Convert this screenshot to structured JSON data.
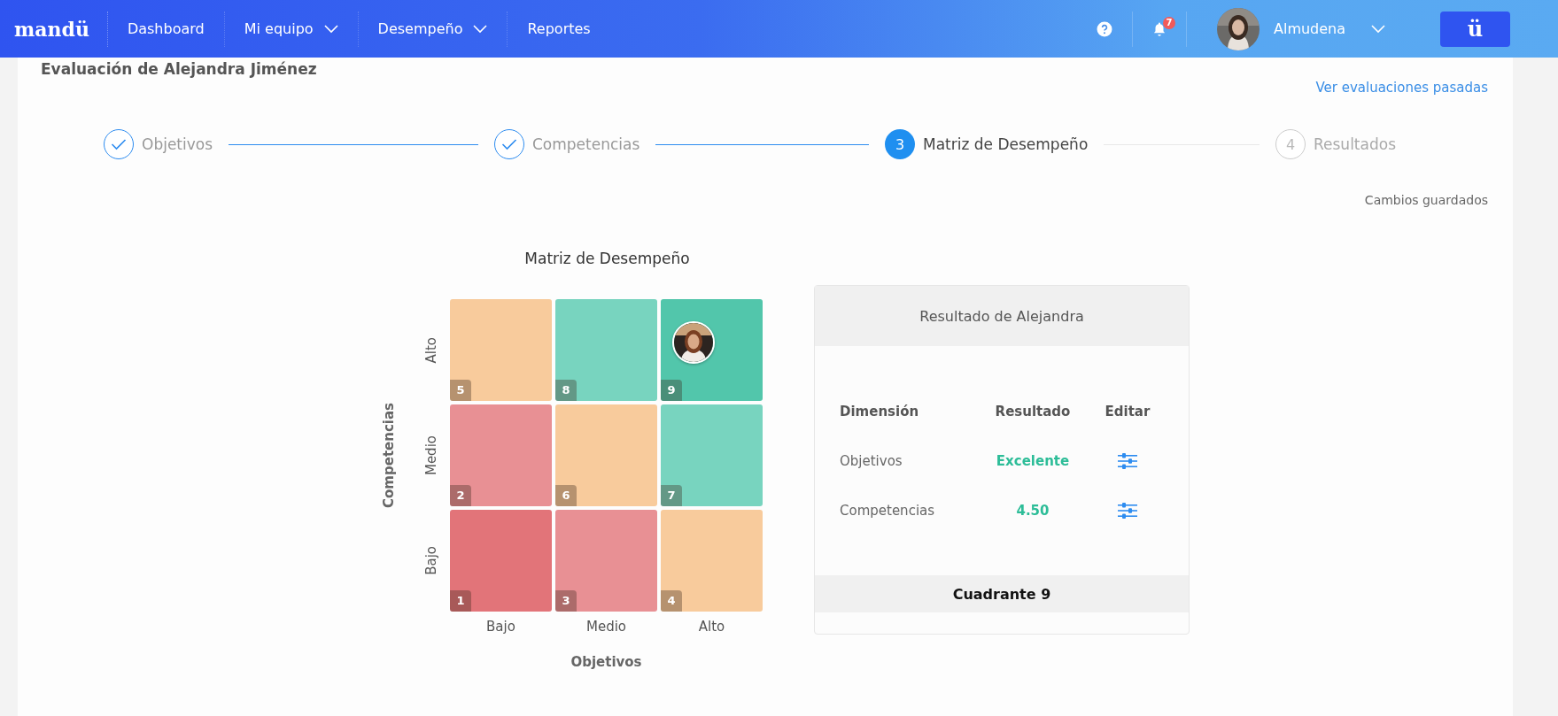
{
  "navbar": {
    "logo": "mandü",
    "items": [
      {
        "label": "Dashboard",
        "dropdown": false
      },
      {
        "label": "Mi equipo",
        "dropdown": true
      },
      {
        "label": "Desempeño",
        "dropdown": true
      },
      {
        "label": "Reportes",
        "dropdown": false
      }
    ],
    "notifications": "7",
    "user": {
      "name": "Almudena"
    },
    "app_button": "ü"
  },
  "page": {
    "title": "Evaluación de Alejandra Jiménez",
    "past_link": "Ver evaluaciones pasadas",
    "save_status": "Cambios guardados"
  },
  "steps": [
    {
      "label": "Objetivos",
      "completed": true,
      "selected": false
    },
    {
      "label": "Competencias",
      "completed": true,
      "selected": false
    },
    {
      "label": "Matriz de Desempeño",
      "number": "3",
      "completed": false,
      "selected": true
    },
    {
      "label": "Resultados",
      "number": "4",
      "completed": false,
      "selected": false
    }
  ],
  "matrix": {
    "title": "Matriz de Desempeño",
    "y_axis": "Competencias",
    "x_axis": "Objetivos",
    "row_labels": [
      "Alto",
      "Medio",
      "Bajo"
    ],
    "column_labels": [
      "Bajo",
      "Medio",
      "Alto"
    ],
    "cells": [
      {
        "number": "5",
        "color": "#f8cb9c",
        "selected": false
      },
      {
        "number": "8",
        "color": "#78d4bf",
        "selected": false
      },
      {
        "number": "9",
        "color": "#52c6ab",
        "selected": true
      },
      {
        "number": "2",
        "color": "#e89094",
        "selected": false
      },
      {
        "number": "6",
        "color": "#f8cb9c",
        "selected": false
      },
      {
        "number": "7",
        "color": "#78d4bf",
        "selected": false
      },
      {
        "number": "1",
        "color": "#e27479",
        "selected": false
      },
      {
        "number": "3",
        "color": "#e89094",
        "selected": false
      },
      {
        "number": "4",
        "color": "#f8cb9c",
        "selected": false
      }
    ]
  },
  "result": {
    "title": "Resultado de Alejandra",
    "columns": [
      "Dimensión",
      "Resultado",
      "Editar"
    ],
    "rows": [
      {
        "dimension": "Objetivos",
        "result": "Excelente"
      },
      {
        "dimension": "Competencias",
        "result": "4.50"
      }
    ],
    "footer": "Cuadrante 9"
  }
}
